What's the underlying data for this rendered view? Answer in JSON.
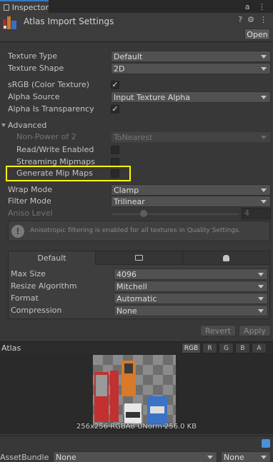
{
  "window": {
    "tab_label": "Inspector",
    "tab_right": "a ⋮"
  },
  "header": {
    "title": "Atlas Import Settings",
    "icons": [
      "help-icon",
      "settings-icon",
      "more-icon"
    ],
    "open_label": "Open"
  },
  "fields": {
    "texture_type": {
      "label": "Texture Type",
      "value": "Default"
    },
    "texture_shape": {
      "label": "Texture Shape",
      "value": "2D"
    },
    "srgb": {
      "label": "sRGB (Color Texture)",
      "checked": "✓"
    },
    "alpha_source": {
      "label": "Alpha Source",
      "value": "Input Texture Alpha"
    },
    "alpha_transparency": {
      "label": "Alpha Is Transparency",
      "checked": "✓"
    },
    "advanced": {
      "label": "Advanced"
    },
    "non_power_of_2": {
      "label": "Non-Power of 2",
      "value": "ToNearest"
    },
    "read_write": {
      "label": "Read/Write Enabled",
      "checked": ""
    },
    "streaming_mipmaps": {
      "label": "Streaming Mipmaps",
      "checked": ""
    },
    "generate_mip_maps": {
      "label": "Generate Mip Maps",
      "checked": ""
    },
    "wrap_mode": {
      "label": "Wrap Mode",
      "value": "Clamp"
    },
    "filter_mode": {
      "label": "Filter Mode",
      "value": "Trilinear"
    },
    "aniso_level": {
      "label": "Aniso Level",
      "value": "4"
    }
  },
  "help": {
    "text": "Anisotropic filtering is enabled for all textures in Quality Settings."
  },
  "platform": {
    "tabs": [
      {
        "label": "Default",
        "icon": ""
      },
      {
        "label": "",
        "icon": "monitor-icon"
      },
      {
        "label": "",
        "icon": "android-icon"
      }
    ],
    "max_size": {
      "label": "Max Size",
      "value": "4096"
    },
    "resize_algorithm": {
      "label": "Resize Algorithm",
      "value": "Mitchell"
    },
    "format": {
      "label": "Format",
      "value": "Automatic"
    },
    "compression": {
      "label": "Compression",
      "value": "None"
    }
  },
  "actions": {
    "revert": "Revert",
    "apply": "Apply"
  },
  "preview": {
    "title": "Atlas",
    "channels": [
      "RGB",
      "R",
      "G",
      "B",
      "A"
    ],
    "info": "256x256  RGBA8 UNorm   256.0 KB"
  },
  "asset_bundle": {
    "label": "AssetBundle",
    "name": "None",
    "variant": "None"
  },
  "colors": {
    "highlight": "#ffff00",
    "accent": "#3a79bb"
  }
}
